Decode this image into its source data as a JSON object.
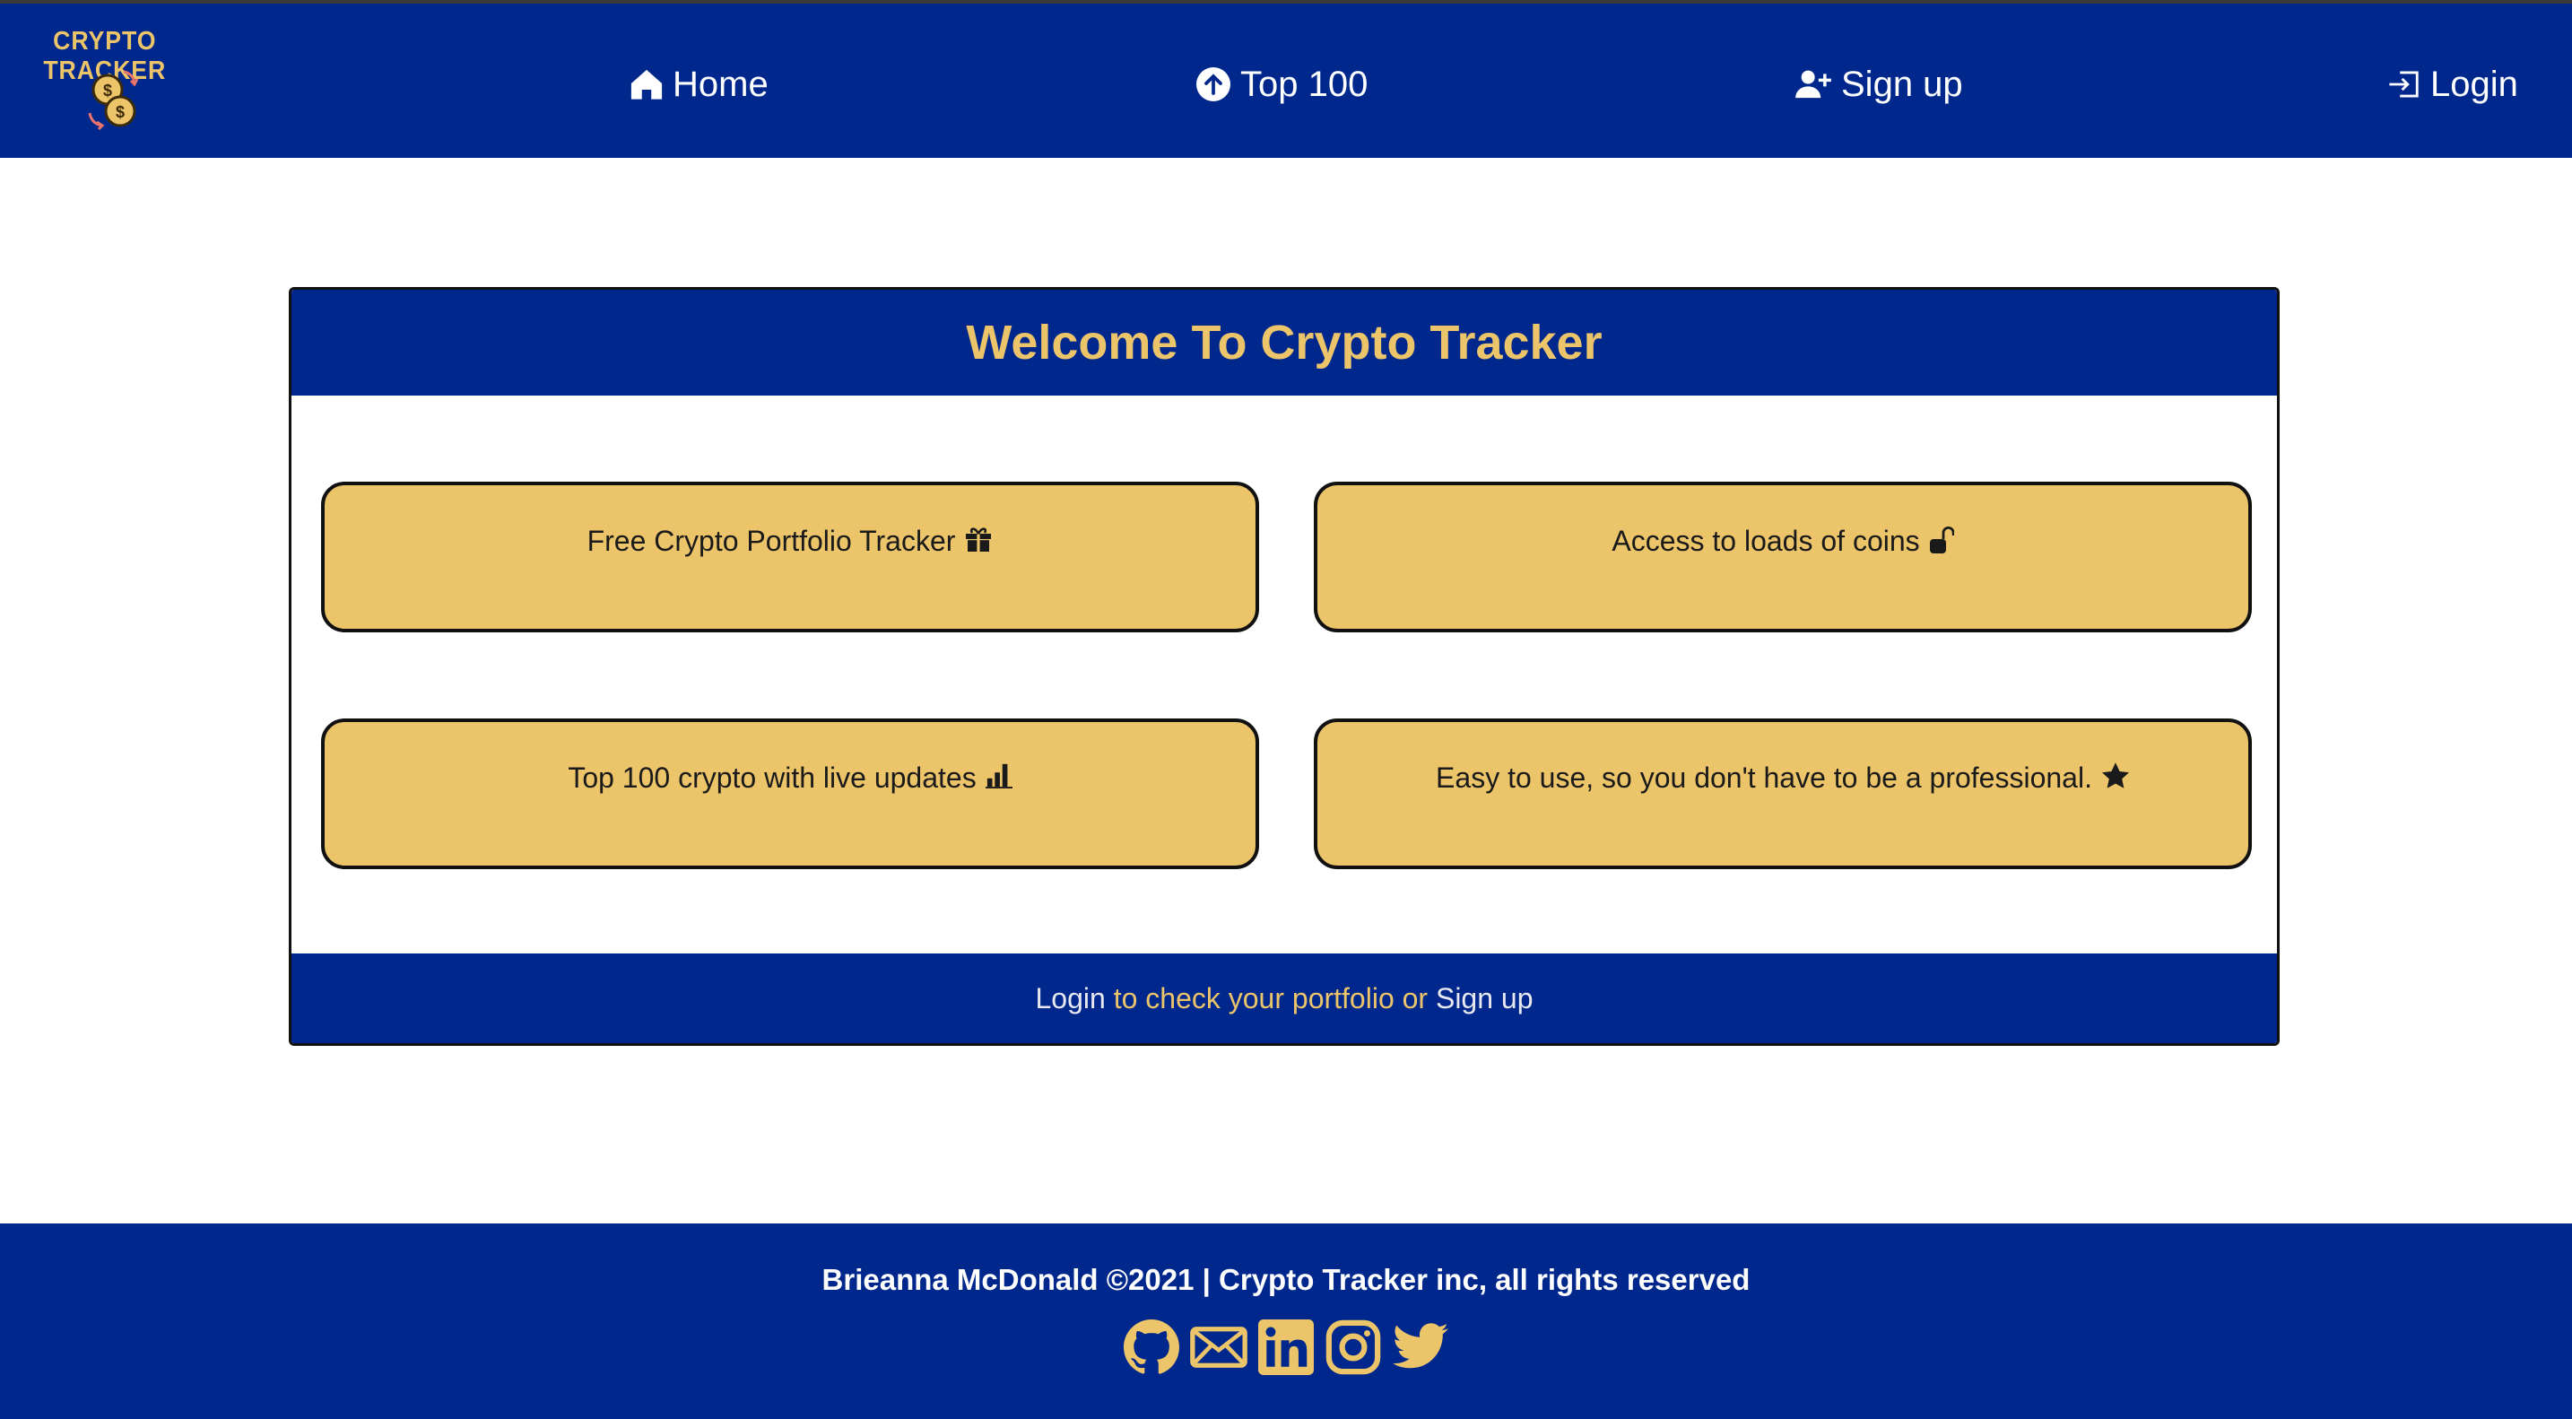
{
  "brand": {
    "name": "CRYPTO TRACKER",
    "logo_icon": "coins-icon"
  },
  "nav": {
    "home": {
      "label": "Home",
      "icon": "house-icon"
    },
    "top100": {
      "label": "Top 100",
      "icon": "arrow-up-circle-icon"
    },
    "signup": {
      "label": "Sign up",
      "icon": "person-plus-icon"
    },
    "login": {
      "label": "Login",
      "icon": "box-arrow-in-icon"
    }
  },
  "welcome": {
    "title": "Welcome To Crypto Tracker",
    "features": [
      {
        "text": "Free Crypto Portfolio Tracker",
        "icon": "gift-icon"
      },
      {
        "text": "Access to loads of coins",
        "icon": "unlock-icon"
      },
      {
        "text": "Top 100 crypto with live updates",
        "icon": "bar-chart-icon"
      },
      {
        "text": "Easy to use, so you don't have to be a professional.",
        "icon": "star-icon"
      }
    ],
    "cta": {
      "login": "Login",
      "middle": "to check your portfolio or",
      "signup": "Sign up"
    }
  },
  "footer": {
    "copyright": "Brieanna McDonald ©2021 | Crypto Tracker inc, all rights reserved",
    "socials": [
      "github-icon",
      "envelope-icon",
      "linkedin-icon",
      "instagram-icon",
      "twitter-icon"
    ]
  },
  "colors": {
    "navy": "#00288c",
    "gold": "#ecc46a",
    "white": "#ffffff"
  }
}
